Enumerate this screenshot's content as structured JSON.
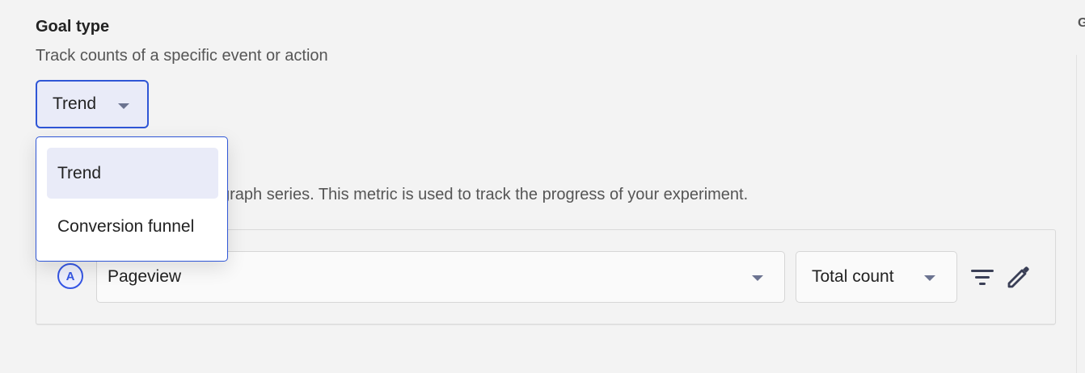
{
  "goal": {
    "title": "Goal type",
    "subtitle": "Track counts of a specific event or action",
    "select": {
      "value": "Trend",
      "icon": "chevron-down-icon"
    },
    "dropdown": {
      "options": [
        {
          "label": "Trend",
          "selected": true
        },
        {
          "label": "Conversion funnel",
          "selected": false
        }
      ]
    }
  },
  "metric": {
    "helptext_visible": "nts can have at most one graph series. This metric is used to track the progress of your experiment.",
    "series": {
      "letter": "A",
      "event": "Pageview",
      "math": "Total count",
      "filter_icon": "filter-icon",
      "edit_icon": "pencil-icon"
    }
  },
  "right_panel": {
    "cut_letter": "G"
  },
  "colors": {
    "accent": "#2f56d6",
    "selected_bg": "#e9ebf8",
    "page_bg": "#f3f3f3"
  }
}
